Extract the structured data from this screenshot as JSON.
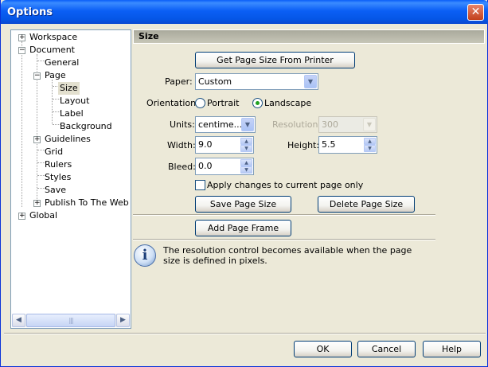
{
  "window": {
    "title": "Options",
    "close_symbol": "✕"
  },
  "tree": {
    "items": [
      {
        "label": "Workspace",
        "expander": "+"
      },
      {
        "label": "Document",
        "expander": "−"
      },
      {
        "label": "General"
      },
      {
        "label": "Page",
        "expander": "−"
      },
      {
        "label": "Size"
      },
      {
        "label": "Layout"
      },
      {
        "label": "Label"
      },
      {
        "label": "Background"
      },
      {
        "label": "Guidelines",
        "expander": "+"
      },
      {
        "label": "Grid"
      },
      {
        "label": "Rulers"
      },
      {
        "label": "Styles"
      },
      {
        "label": "Save"
      },
      {
        "label": "Publish To The Web",
        "expander": "+"
      },
      {
        "label": "Global",
        "expander": "+"
      }
    ],
    "selected": "Size",
    "scroll_left": "◀",
    "scroll_right": "▶",
    "scroll_grip": "|||"
  },
  "panel": {
    "header": "Size",
    "get_page_size_button": "Get Page Size From Printer",
    "paper_label": "Paper:",
    "paper_value": "Custom",
    "orientation_label": "Orientation:",
    "portrait_label": "Portrait",
    "landscape_label": "Landscape",
    "orientation_selected": "Landscape",
    "units_label": "Units:",
    "units_value": "centime...",
    "resolution_label": "Resolution:",
    "resolution_value": "300",
    "width_label": "Width:",
    "width_value": "9.0",
    "height_label": "Height:",
    "height_value": "5.5",
    "bleed_label": "Bleed:",
    "bleed_value": "0.0",
    "apply_current_label": "Apply changes to current page only",
    "apply_current_checked": false,
    "save_page_size_button": "Save Page Size",
    "delete_page_size_button": "Delete Page Size",
    "add_page_frame_button": "Add Page Frame",
    "info_symbol": "i",
    "info_text": "The resolution control becomes available when the page size is defined in pixels."
  },
  "footer": {
    "ok_button": "OK",
    "cancel_button": "Cancel",
    "help_button": "Help"
  },
  "colors": {
    "titlebar": "#0b5ff5",
    "dialog_bg": "#ece9d8",
    "header_bg": "#b8b7a9",
    "radio_dot": "#21a121"
  }
}
